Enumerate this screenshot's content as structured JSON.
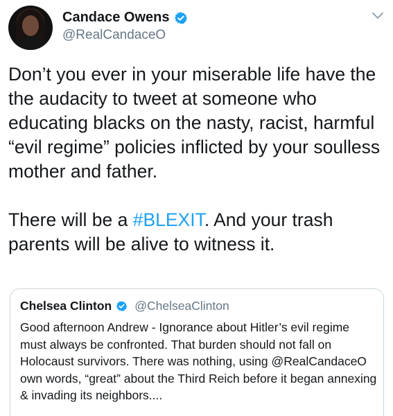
{
  "author": {
    "display_name": "Candace Owens",
    "handle": "@RealCandaceO",
    "verified": true
  },
  "icons": {
    "verified": "verified-badge-icon",
    "menu": "chevron-down-icon"
  },
  "colors": {
    "link": "#1da1f2",
    "secondary_text": "#657786",
    "border": "#ccd6dd"
  },
  "tweet": {
    "paragraph_1": "Don’t you ever in your miserable life have the the audacity to tweet at someone who educating blacks on the nasty, racist, harmful “evil regime” policies inflicted by your soulless mother and father.",
    "paragraph_2_before": "There will be a ",
    "hashtag": "#BLEXIT",
    "paragraph_2_after": ". And your trash parents will be alive to witness it."
  },
  "quoted_tweet": {
    "display_name": "Chelsea Clinton",
    "handle": "@ChelseaClinton",
    "verified": true,
    "text": "Good afternoon Andrew - Ignorance about Hitler’s evil regime must always be confronted. That burden should not fall on Holocaust survivors. There was nothing, using @RealCandaceO own words, “great” about the Third Reich before it began annexing & invading its neighbors...."
  }
}
